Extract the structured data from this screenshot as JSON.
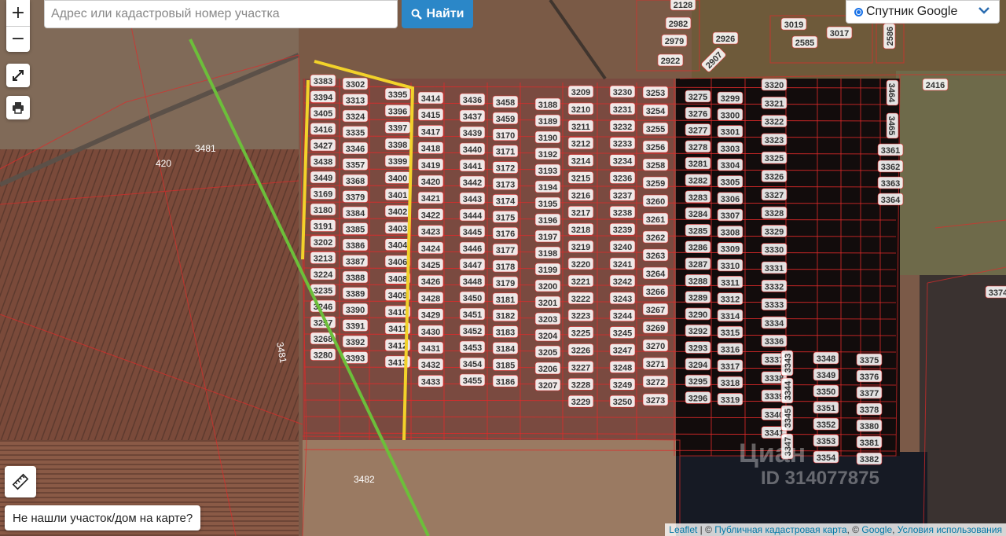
{
  "search": {
    "placeholder": "Адрес или кадастровый номер участка",
    "button_label": "Найти"
  },
  "zoom": {
    "in_label": "+",
    "out_label": "−"
  },
  "layer": {
    "selected": "Спутник Google"
  },
  "not_found_label": "Не нашли участок/дом на карте?",
  "attribution": {
    "leaflet": "Leaflet",
    "sep1": " | © ",
    "pkk": "Публичная кадастровая карта",
    "sep2": ", © ",
    "google": "Google",
    "sep3": ", ",
    "terms": "Условия использования"
  },
  "watermark": {
    "brand": "Циан",
    "id": "ID 314077875"
  },
  "colors": {
    "highlight": "#3cd24a",
    "line_yellow": "#f2d22a",
    "line_green": "#6cbf3a",
    "boundary": "#e02a2a"
  },
  "area_labels": [
    "3481",
    "420",
    "3481",
    "3482",
    "2416"
  ],
  "top_labels": [
    "2128",
    "2982",
    "2979",
    "2922",
    "2926",
    "2907",
    "3019",
    "2585",
    "3017",
    "2586"
  ],
  "col1": [
    "3383",
    "3394",
    "3405",
    "3416",
    "3427",
    "3438",
    "3449",
    "3169",
    "3180",
    "3191",
    "3202",
    "3213",
    "3224",
    "3235",
    "3246",
    "3257",
    "3268",
    "3280"
  ],
  "col2": [
    "3302",
    "3313",
    "3324",
    "3335",
    "3346",
    "3357",
    "3368",
    "3379",
    "3384",
    "3385",
    "3386",
    "3387",
    "3388",
    "3389",
    "3390",
    "3391",
    "3392",
    "3393"
  ],
  "col3": [
    "3395",
    "3396",
    "3397",
    "3398",
    "3399",
    "3400",
    "3401",
    "3402",
    "3403",
    "3404",
    "3406",
    "3408",
    "3409",
    "3410",
    "3411",
    "3412",
    "3413"
  ],
  "col4": [
    "3414",
    "3415",
    "3417",
    "3418",
    "3419",
    "3420",
    "3421",
    "3422",
    "3423",
    "3424",
    "3425",
    "3426",
    "3428",
    "3429",
    "3430",
    "3431",
    "3432",
    "3433"
  ],
  "col5": [
    "3436",
    "3437",
    "3439",
    "3440",
    "3441",
    "3442",
    "3443",
    "3444",
    "3445",
    "3446",
    "3447",
    "3448",
    "3450",
    "3451",
    "3452",
    "3453",
    "3454",
    "3455"
  ],
  "col6": [
    "3458",
    "3459",
    "3170",
    "3171",
    "3172",
    "3173",
    "3174",
    "3175",
    "3176",
    "3177",
    "3178",
    "3179",
    "3181",
    "3182",
    "3183",
    "3184",
    "3185",
    "3186"
  ],
  "col7": [
    "3188",
    "3189",
    "3190",
    "3192",
    "3193",
    "3194",
    "3195",
    "3196",
    "3197",
    "3198",
    "3199",
    "3200",
    "3201",
    "3203",
    "3204",
    "3205",
    "3206",
    "3207"
  ],
  "col8": [
    "3209",
    "3210",
    "3211",
    "3212",
    "3214",
    "3215",
    "3216",
    "3217",
    "3218",
    "3219",
    "3220",
    "3221",
    "3222",
    "3223",
    "3225",
    "3226",
    "3227",
    "3228",
    "3229"
  ],
  "col9": [
    "3230",
    "3231",
    "3232",
    "3233",
    "3234",
    "3236",
    "3237",
    "3238",
    "3239",
    "3240",
    "3241",
    "3242",
    "3243",
    "3244",
    "3245",
    "3247",
    "3248",
    "3249",
    "3250"
  ],
  "col10": [
    "3253",
    "3254",
    "3255",
    "3256",
    "3258",
    "3259",
    "3260",
    "3261",
    "3262",
    "3263",
    "3264",
    "3266",
    "3267",
    "3269",
    "3270",
    "3271",
    "3272",
    "3273"
  ],
  "col11": [
    "3275",
    "3276",
    "3277",
    "3278",
    "3281",
    "3282",
    "3283",
    "3284",
    "3285",
    "3286",
    "3287",
    "3288",
    "3289",
    "3290",
    "3292",
    "3293",
    "3294",
    "3295",
    "3296"
  ],
  "col12": [
    "3299",
    "3300",
    "3301",
    "3303",
    "3304",
    "3305",
    "3306",
    "3307",
    "3308",
    "3309",
    "3310",
    "3311",
    "3312",
    "3314",
    "3315",
    "3316",
    "3317",
    "3318",
    "3319"
  ],
  "col13": [
    "3320",
    "3321",
    "3322",
    "3323",
    "3325",
    "3326",
    "3327",
    "3328",
    "3329",
    "3330",
    "3331",
    "3332",
    "3333",
    "3334",
    "3336",
    "3337",
    "3338",
    "3339",
    "3340",
    "3341"
  ],
  "rot_labels": [
    "3343",
    "3344",
    "3345",
    "3347",
    "3464",
    "3465"
  ],
  "col14": [
    "3348",
    "3349",
    "3350",
    "3351",
    "3352",
    "3353",
    "3354"
  ],
  "col15": [
    "3375",
    "3376",
    "3377",
    "3378",
    "3380",
    "3381",
    "3382"
  ],
  "col16": [
    "3361",
    "3362",
    "3363",
    "3364"
  ],
  "edge_label": "3374"
}
